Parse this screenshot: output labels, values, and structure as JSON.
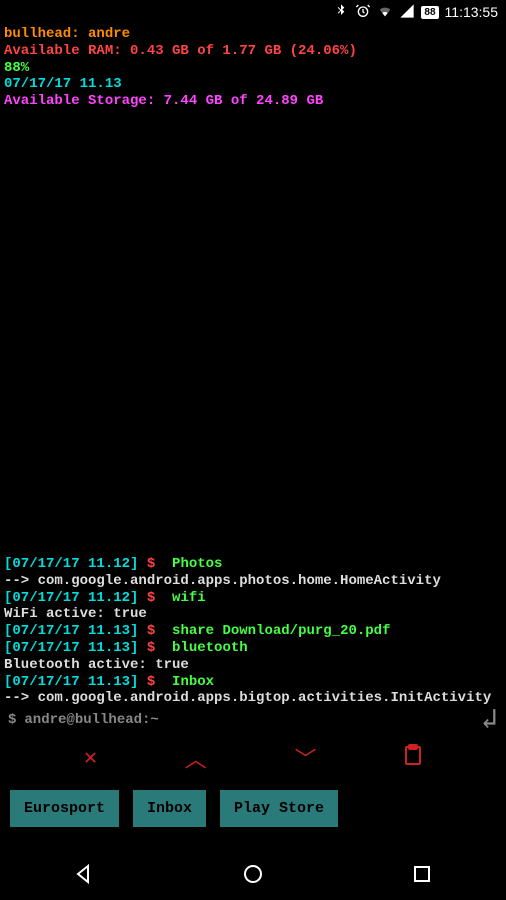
{
  "status_bar": {
    "battery_pct": "88",
    "time": "11:13:55"
  },
  "header": {
    "host_user": "bullhead: andre",
    "ram_line": "Available RAM: 0.43 GB of 1.77 GB (24.06%)",
    "battery_line": "88%",
    "date_line": "07/17/17 11.13",
    "storage_line": "Available Storage: 7.44 GB of 24.89 GB"
  },
  "log": {
    "l1_ts": "[07/17/17 11.12]",
    "l1_d": " $ ",
    "l1_cmd": " Photos",
    "l1_out": "--> com.google.android.apps.photos.home.HomeActivity",
    "l2_ts": "[07/17/17 11.12]",
    "l2_d": " $ ",
    "l2_cmd": " wifi",
    "l2_out": "WiFi active: true",
    "l3_ts": "[07/17/17 11.13]",
    "l3_d": " $ ",
    "l3_cmd": " share Download/purg_20.pdf",
    "l4_ts": "[07/17/17 11.13]",
    "l4_d": " $ ",
    "l4_cmd": " bluetooth",
    "l4_out": "Bluetooth active: true",
    "l5_ts": "[07/17/17 11.13]",
    "l5_d": " $ ",
    "l5_cmd": " Inbox",
    "l5_out": "--> com.google.android.apps.bigtop.activities.InitActivity"
  },
  "prompt": {
    "dollar": "$",
    "text": "andre@bullhead:~"
  },
  "toolbar": {
    "close": "✕",
    "up": "︿",
    "down": "﹀",
    "clipboard": "📋"
  },
  "shortcuts": {
    "b1": "Eurosport",
    "b2": "Inbox",
    "b3": "Play Store"
  }
}
